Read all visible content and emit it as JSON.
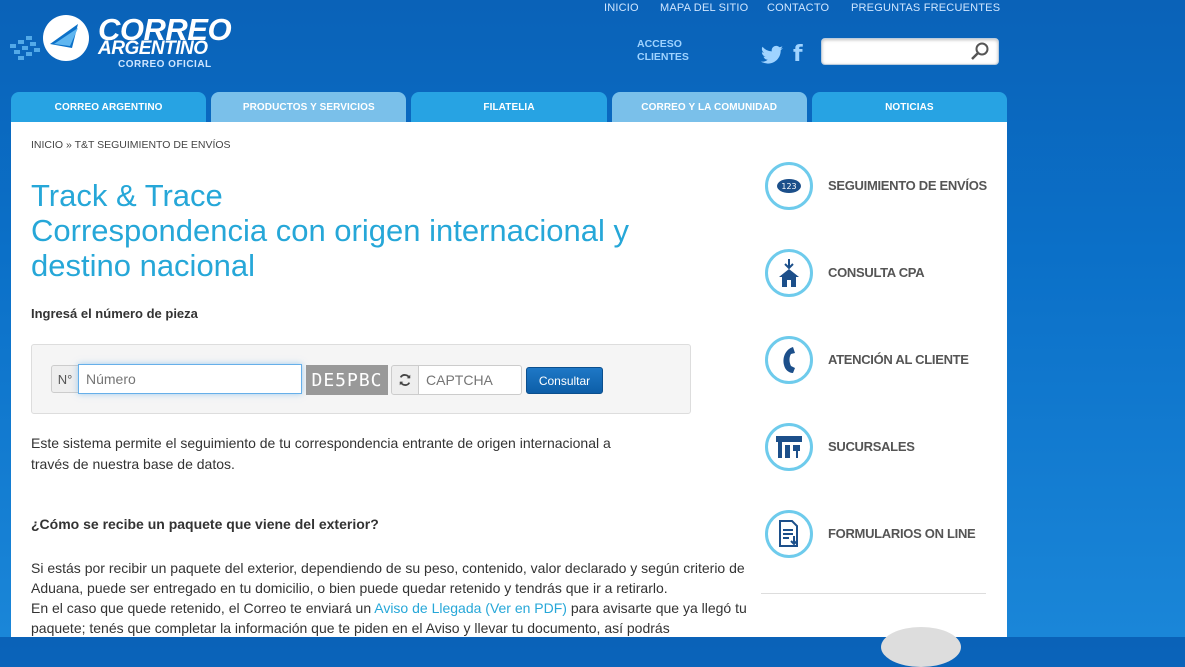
{
  "header": {
    "brand_line1": "CORREO",
    "brand_line2": "ARGENTINO",
    "brand_tagline": "CORREO OFICIAL",
    "top_links": [
      "INICIO",
      "MAPA DEL SITIO",
      "CONTACTO",
      "PREGUNTAS FRECUENTES"
    ],
    "acceso_line1": "ACCESO",
    "acceso_line2": "CLIENTES",
    "search_placeholder": ""
  },
  "mainnav": [
    "CORREO ARGENTINO",
    "PRODUCTOS Y SERVICIOS",
    "FILATELIA",
    "CORREO Y LA COMUNIDAD",
    "NOTICIAS"
  ],
  "breadcrumb": {
    "home": "INICIO",
    "sep": " » ",
    "current": "T&T SEGUIMIENTO DE ENVÍOS"
  },
  "title_line1": "Track & Trace",
  "title_line2": "Correspondencia con origen internacional y destino nacional",
  "form": {
    "label": "Ingresá el número de pieza",
    "prefix": "N°",
    "numero_placeholder": "Número",
    "captcha_text": "DE5PBC",
    "captcha_placeholder": "CAPTCHA",
    "submit": "Consultar"
  },
  "intro": "Este sistema permite el seguimiento de tu correspondencia entrante de origen internacional a través de nuestra base de datos.",
  "question": "¿Cómo se recibe un paquete que viene del exterior?",
  "para_part1": "Si estás por recibir un paquete del exterior, dependiendo de su peso, contenido, valor declarado y según criterio de Aduana, puede ser entregado en tu domicilio, o bien puede quedar retenido y tendrás que ir a retirarlo.",
  "para_part2": "En el caso que quede retenido, el Correo te enviará un ",
  "para_link": "Aviso de Llegada (Ver en PDF)",
  "para_part3": " para avisarte que ya llegó tu paquete; tenés que completar la información que te piden en el Aviso y llevar tu documento, así podrás",
  "sidebar": [
    {
      "label": "SEGUIMIENTO DE ENVÍOS",
      "icon": "tracking-icon",
      "icon_text": "123"
    },
    {
      "label": "CONSULTA CPA",
      "icon": "house-icon"
    },
    {
      "label": "ATENCIÓN AL CLIENTE",
      "icon": "phone-icon"
    },
    {
      "label": "SUCURSALES",
      "icon": "branch-icon"
    },
    {
      "label": "FORMULARIOS ON LINE",
      "icon": "form-icon"
    }
  ],
  "colors": {
    "accent": "#26a7d8",
    "tab_dark": "#27a3e3",
    "tab_light": "#7ac0ea",
    "header_bg": "#0b70c8"
  }
}
